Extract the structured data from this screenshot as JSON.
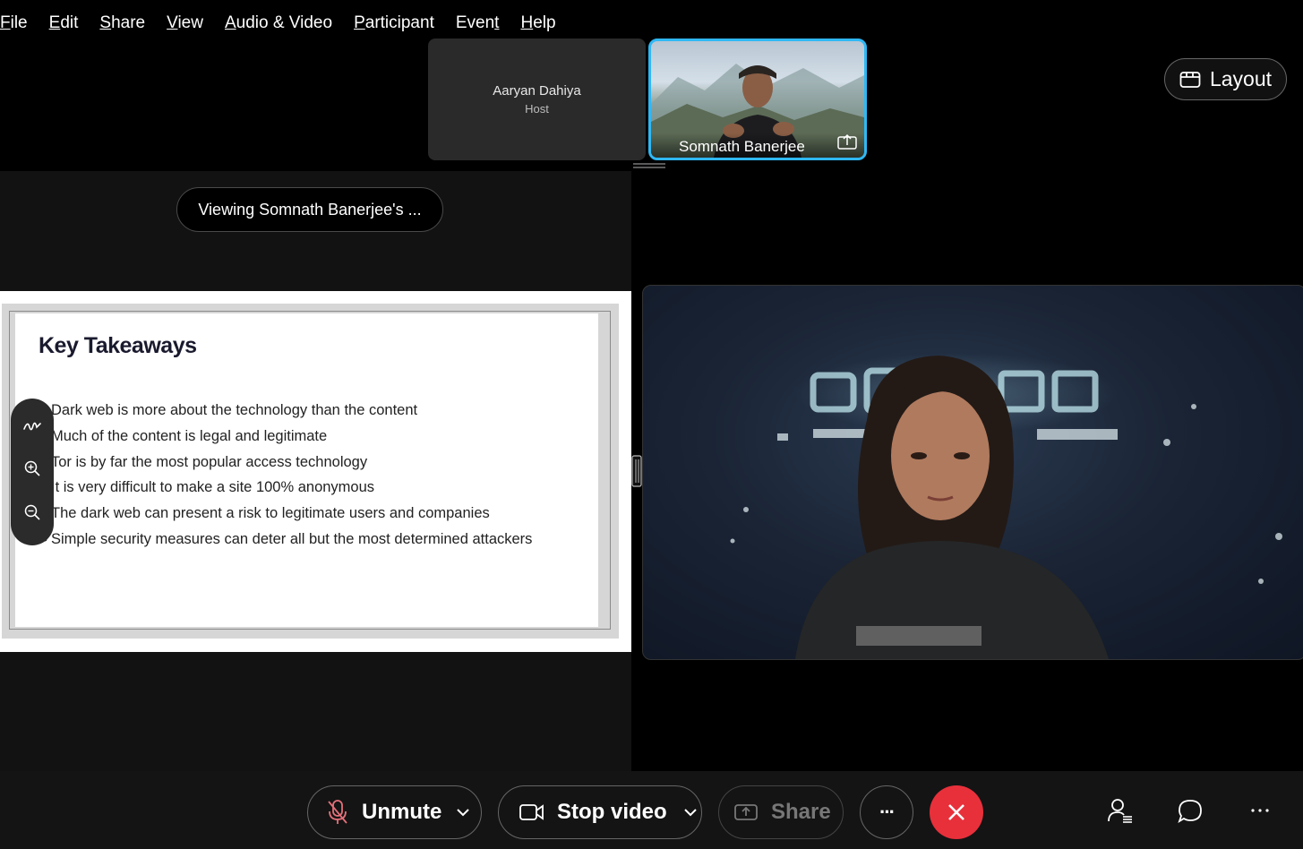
{
  "menu": [
    {
      "label": "File",
      "accel": "F",
      "rest": "ile"
    },
    {
      "label": "Edit",
      "accel": "E",
      "rest": "dit"
    },
    {
      "label": "Share",
      "accel": "S",
      "rest": "hare"
    },
    {
      "label": "View",
      "accel": "V",
      "rest": "iew"
    },
    {
      "label": "Audio & Video",
      "accel": "A",
      "rest": "udio & Video"
    },
    {
      "label": "Participant",
      "accel": "P",
      "rest": "articipant"
    },
    {
      "label": "Event",
      "pre": "Even",
      "accel": "t",
      "rest": ""
    },
    {
      "label": "Help",
      "accel": "H",
      "rest": "elp"
    }
  ],
  "participants": {
    "host": {
      "name": "Aaryan Dahiya",
      "role": "Host"
    },
    "active": {
      "name": "Somnath Banerjee"
    }
  },
  "layout_button": {
    "label": "Layout"
  },
  "share": {
    "viewing_label": "Viewing Somnath Banerjee's ...",
    "slide": {
      "title": "Key Takeaways",
      "bullets": [
        "Dark web is more about the technology than the content",
        "Much of the content is legal and legitimate",
        "Tor is by far the most popular access technology",
        "It is very difficult to make a site 100% anonymous",
        "The dark web can present a risk to legitimate users and companies",
        "Simple security measures can deter all but the most determined attackers"
      ]
    }
  },
  "toolbar": {
    "unmute": "Unmute",
    "stop_video": "Stop video",
    "share": "Share",
    "more": "···"
  },
  "colors": {
    "active_border": "#2fb8f5",
    "end_call": "#e8303b",
    "muted_icon": "#e5707a"
  }
}
